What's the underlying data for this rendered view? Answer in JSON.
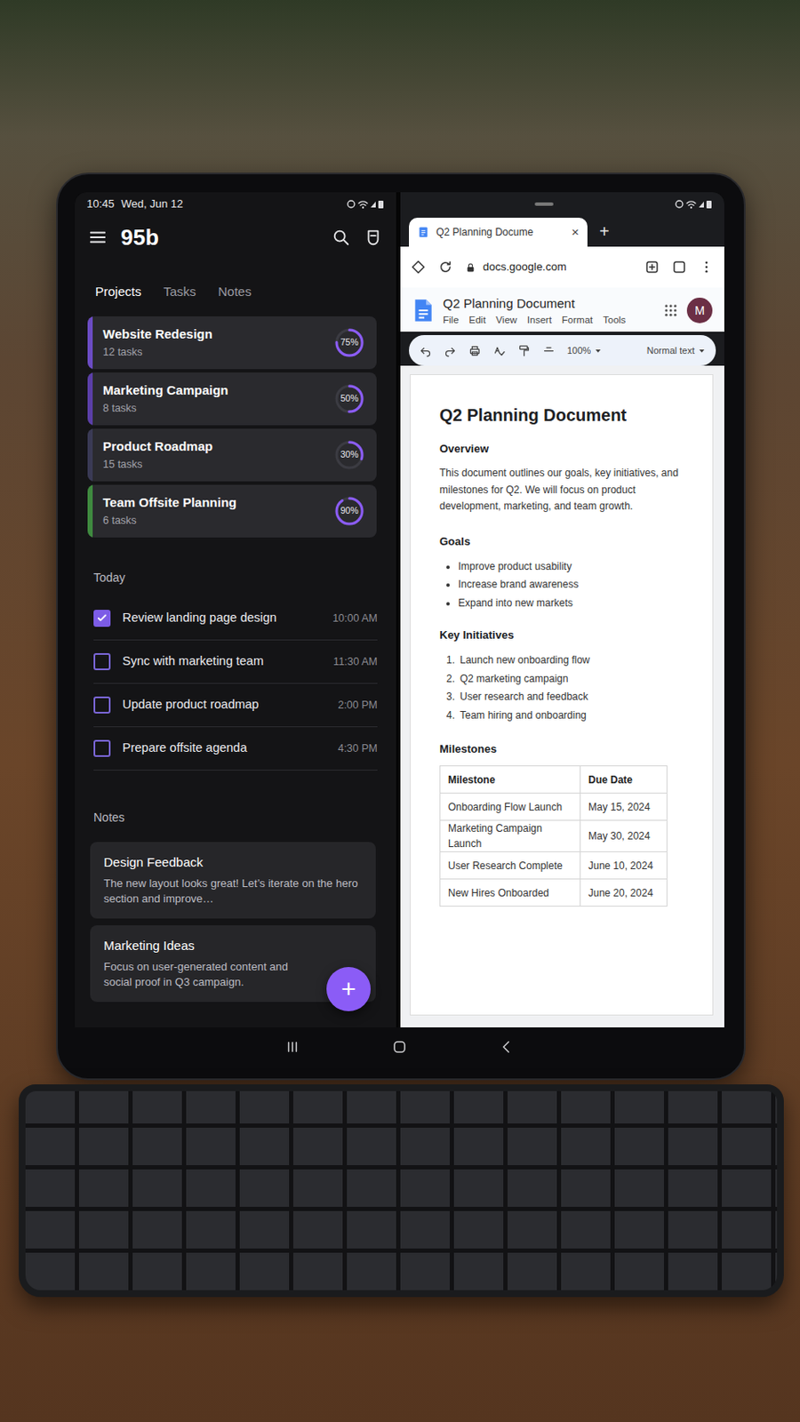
{
  "left_status": {
    "time": "10:45",
    "date": "Wed, Jun 12"
  },
  "app": {
    "title": "95b"
  },
  "tabs": [
    {
      "label": "Projects",
      "selected": true
    },
    {
      "label": "Tasks",
      "selected": false
    },
    {
      "label": "Notes",
      "selected": false
    }
  ],
  "projects": [
    {
      "name": "Website Redesign",
      "tasks": "12 tasks",
      "level": 0.75,
      "reading": "75%",
      "color": "#6c4cc4"
    },
    {
      "name": "Marketing Campaign",
      "tasks": "8 tasks",
      "level": 0.5,
      "reading": "50%",
      "color": "#5b3fa8"
    },
    {
      "name": "Product Roadmap",
      "tasks": "15 tasks",
      "level": 0.3,
      "reading": "30%",
      "color": "#3a3a55"
    },
    {
      "name": "Team Offsite Planning",
      "tasks": "6 tasks",
      "level": 0.9,
      "reading": "90%",
      "color": "#3f8a3f"
    }
  ],
  "today": {
    "label": "Today",
    "tasks": [
      {
        "title": "Review landing page design",
        "time": "10:00 AM",
        "checked": true
      },
      {
        "title": "Sync with marketing team",
        "time": "11:30 AM",
        "checked": false
      },
      {
        "title": "Update product roadmap",
        "time": "2:00 PM",
        "checked": false
      },
      {
        "title": "Prepare offsite agenda",
        "time": "4:30 PM",
        "checked": false
      }
    ]
  },
  "notes": {
    "label": "Notes",
    "items": [
      {
        "title": "Design Feedback",
        "body": "The new layout looks great! Let’s iterate on the hero section and improve…"
      },
      {
        "title": "Marketing Ideas",
        "body": "Focus on user-generated content and social proof in Q3 campaign."
      }
    ]
  },
  "fab": "+",
  "browser": {
    "tab_title": "Q2 Planning Docume",
    "tab_close": "×",
    "new_tab": "+",
    "url": "docs.google.com"
  },
  "docs": {
    "title": "Q2 Planning Document",
    "menus": [
      "File",
      "Edit",
      "View",
      "Insert",
      "Format",
      "Tools"
    ],
    "avatar": "M",
    "zoom": "100%",
    "style": "Normal text"
  },
  "document": {
    "title": "Q2 Planning Document",
    "overview": {
      "heading": "Overview",
      "text": "This document outlines our goals, key initiatives, and milestones for Q2. We will focus on product development, marketing, and team growth."
    },
    "goals": {
      "heading": "Goals",
      "items": [
        "Improve product usability",
        "Increase brand awareness",
        "Expand into new markets"
      ]
    },
    "initiatives": {
      "heading": "Key Initiatives",
      "items": [
        {
          "number": "1.",
          "text": "Launch new onboarding flow"
        },
        {
          "number": "2.",
          "text": "Q2 marketing campaign"
        },
        {
          "number": "3.",
          "text": "User research and feedback"
        },
        {
          "number": "4.",
          "text": "Team hiring and onboarding"
        }
      ]
    },
    "milestones": {
      "heading": "Milestones",
      "columns": [
        "Milestone",
        "Due Date"
      ],
      "rows": [
        [
          "Onboarding Flow Launch",
          "May 15, 2024"
        ],
        [
          "Marketing Campaign Launch",
          "May 30, 2024"
        ],
        [
          "User Research Complete",
          "June 10, 2024"
        ],
        [
          "New Hires Onboarded",
          "June 20, 2024"
        ]
      ]
    }
  }
}
